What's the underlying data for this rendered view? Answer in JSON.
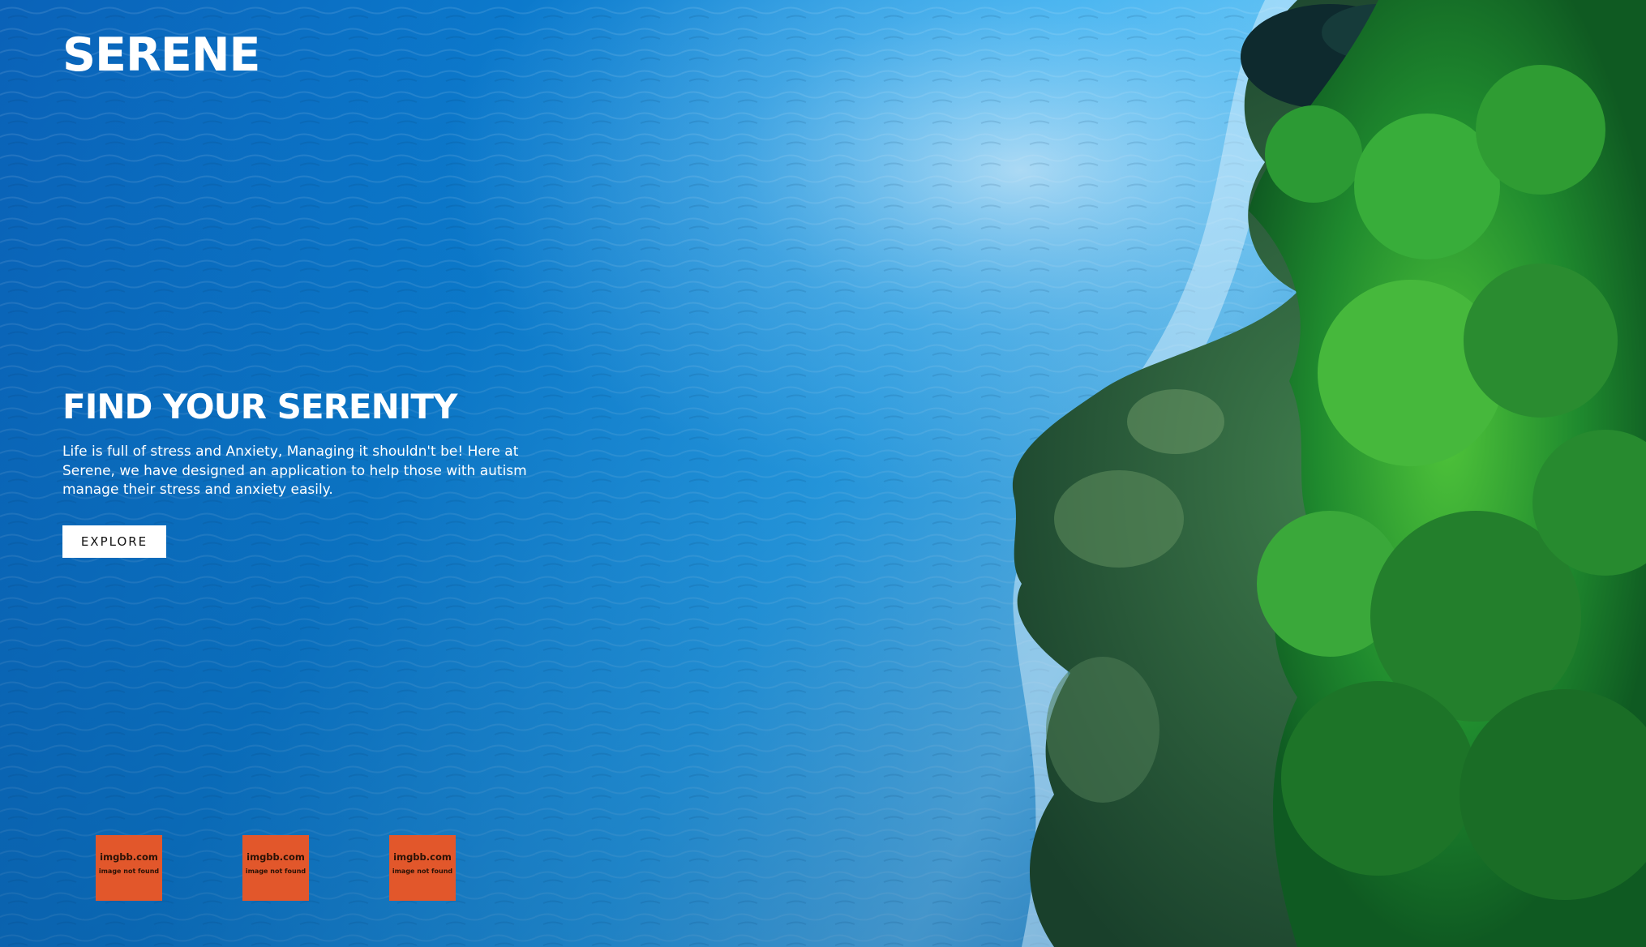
{
  "brand": {
    "logo_text": "SERENE"
  },
  "hero": {
    "headline": "FIND YOUR SERENITY",
    "description": "Life is full of stress and Anxiety, Managing it shouldn't be! Here at Serene, we have designed an application to help those with autism manage their stress and anxiety easily.",
    "cta_label": "EXPLORE",
    "background": "aerial view of blue ocean water meeting a green forested rocky coastline"
  },
  "thumbnails": [
    {
      "brand": "imgbb.com",
      "note": "image not found"
    },
    {
      "brand": "imgbb.com",
      "note": "image not found"
    },
    {
      "brand": "imgbb.com",
      "note": "image not found"
    }
  ],
  "colors": {
    "ocean": "#0a6fc0",
    "foliage": "#1f8a2e",
    "placeholder": "#e2572b",
    "text": "#ffffff",
    "button_bg": "#ffffff"
  }
}
